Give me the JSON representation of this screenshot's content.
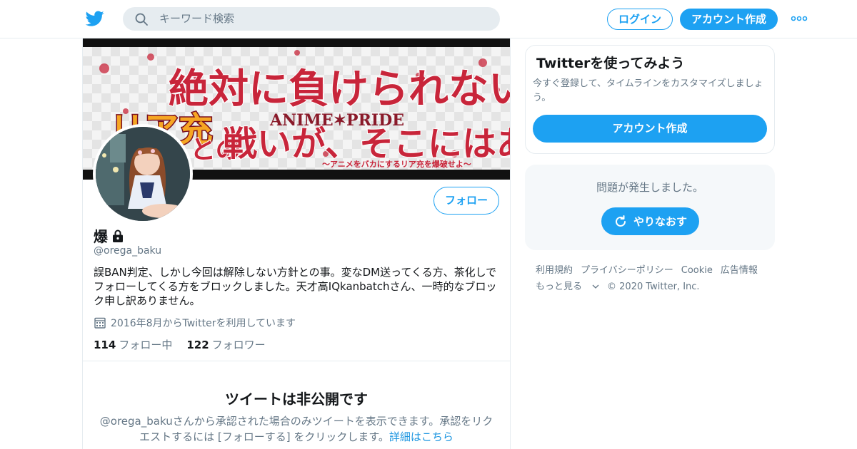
{
  "nav": {
    "search_placeholder": "キーワード検索",
    "login_label": "ログイン",
    "signup_label": "アカウント作成"
  },
  "banner": {
    "line1": "絶対に負けられない",
    "line2a": "リア充",
    "line2b": "との",
    "line2c": "戦いが、そこにはある",
    "logo": "ANIME✶PRIDE",
    "sub": "〜アニメをバカにするリア充を爆破せよ〜"
  },
  "profile": {
    "follow_label": "フォロー",
    "name": "爆",
    "handle": "@orega_baku",
    "bio": "誤BAN判定、しかし今回は解除しない方針との事。変なDM送ってくる方、茶化しでフォローしてくる方をブロックしました。天才高IQkanbatchさん、一時的なブロック申し訳ありません。",
    "joined": "2016年8月からTwitterを利用しています",
    "following_count": "114",
    "following_label": "フォロー中",
    "followers_count": "122",
    "followers_label": "フォロワー"
  },
  "protected": {
    "title": "ツイートは非公開です",
    "desc": "@orega_bakuさんから承認された場合のみツイートを表示できます。承認をリクエストするには [フォローする] をクリックします。",
    "link": "詳細はこちら"
  },
  "signup_card": {
    "title": "Twitterを使ってみよう",
    "desc": "今すぐ登録して、タイムラインをカスタマイズしましょう。",
    "button": "アカウント作成"
  },
  "error_card": {
    "message": "問題が発生しました。",
    "retry": "やりなおす"
  },
  "footer": {
    "links": [
      "利用規約",
      "プライバシーポリシー",
      "Cookie",
      "広告情報"
    ],
    "more": "もっと見る",
    "copyright": "© 2020 Twitter, Inc."
  },
  "colors": {
    "accent": "#1da1f2",
    "text": "#14171a",
    "secondary": "#657786",
    "border": "#e6ecf0",
    "banner_red": "#c8253a"
  }
}
